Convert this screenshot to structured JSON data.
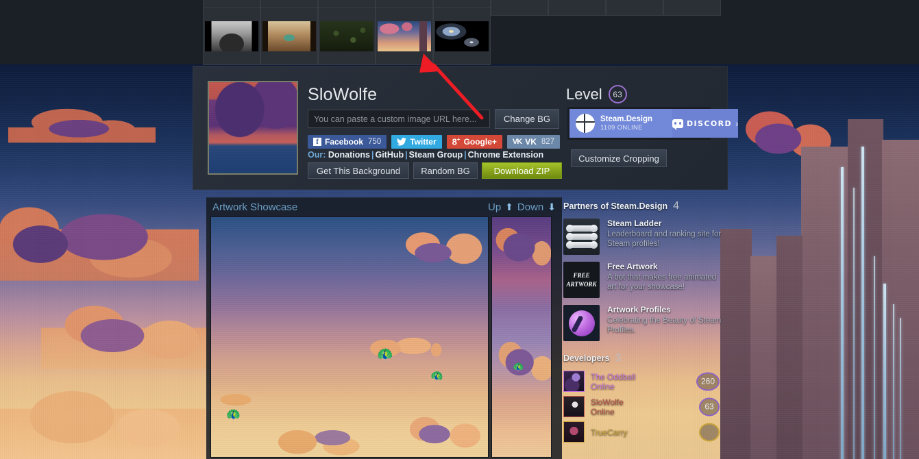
{
  "thumbnail_strip": {
    "row1_count": 9,
    "row2": [
      {
        "name": "interior-dark-room"
      },
      {
        "name": "interior-warm-room"
      },
      {
        "name": "forest-map"
      },
      {
        "name": "pixel-sunset-cliff"
      },
      {
        "name": "galaxies"
      }
    ]
  },
  "header": {
    "username": "SloWolfe",
    "url_input": {
      "value": "",
      "placeholder": "You can paste a custom image URL here..."
    },
    "change_bg_label": "Change BG",
    "social": [
      {
        "name": "facebook",
        "label": "Facebook",
        "count": "750",
        "color": "#3b5998"
      },
      {
        "name": "twitter",
        "label": "Twitter",
        "count": "",
        "color": "#31a9e1"
      },
      {
        "name": "google-plus",
        "label": "Google+",
        "count": "",
        "color": "#d34836"
      },
      {
        "name": "vk",
        "label": "VK",
        "count": "827",
        "color": "#6c88a8"
      }
    ],
    "our_label": "Our:",
    "our_links": [
      "Donations",
      "GitHub",
      "Steam Group",
      "Chrome Extension"
    ],
    "actions": [
      {
        "name": "get-this-background",
        "label": "Get This Background"
      },
      {
        "name": "random-bg",
        "label": "Random BG"
      },
      {
        "name": "download-zip",
        "label": "Download ZIP",
        "color": "#8aa81c"
      }
    ],
    "level_label": "Level",
    "level_value": "63",
    "discord": {
      "server_name": "Steam.Design",
      "online_text": "1109 ONLINE",
      "brand": "DISCORD",
      "arrow": "›",
      "accent": "#7289da"
    },
    "customize_cropping_label": "Customize Cropping"
  },
  "showcase": {
    "title": "Artwork Showcase",
    "up_label": "Up",
    "down_label": "Down",
    "up_arrow": "⬆",
    "down_arrow": "⬇"
  },
  "sidebar": {
    "partners_title": "Partners of Steam.Design",
    "partners_count": "4",
    "partners": [
      {
        "icon": "steam-ladder-icon",
        "title": "Steam Ladder",
        "desc": "Leaderboard and ranking site for Steam profiles!"
      },
      {
        "icon": "free-artwork-icon",
        "icon_text_line1": "FREE",
        "icon_text_line2": "ARTWORK",
        "title": "Free Artwork",
        "desc": "A bot that makes free animated art for your showcase!"
      },
      {
        "icon": "artwork-profiles-icon",
        "title": "Artwork Profiles",
        "desc": "Celebrating the Beauty of Steam Profiles."
      }
    ],
    "developers_title": "Developers",
    "developers_count": "3",
    "developers": [
      {
        "name": "The Oddball",
        "status": "Online",
        "level": "260",
        "color": "#d07ae8"
      },
      {
        "name": "SloWolfe",
        "status": "Online",
        "level": "63",
        "color": "#b8544c"
      },
      {
        "name": "TrueCarry",
        "status": "",
        "level": "",
        "color": "#c8a33c"
      }
    ]
  },
  "annotation": {
    "arrow_color": "#ee1c24",
    "points_to": "pixel-sunset-cliff thumbnail"
  }
}
